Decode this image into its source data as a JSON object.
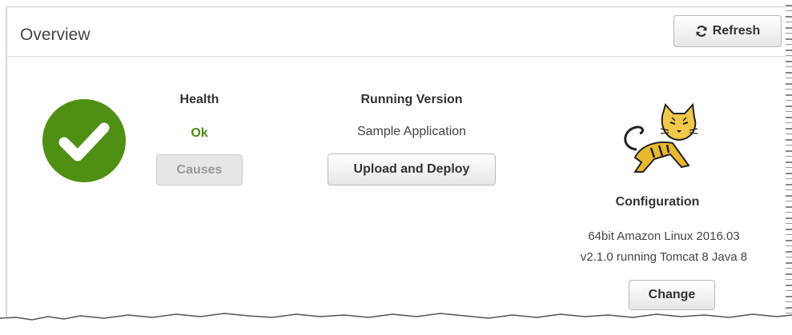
{
  "header": {
    "title": "Overview",
    "refresh_label": "Refresh",
    "refresh_icon": "refresh-icon"
  },
  "health": {
    "title": "Health",
    "status": "Ok",
    "status_color": "#4a8a12",
    "indicator_color": "#4f8f14",
    "indicator_icon": "checkmark-icon",
    "causes_label": "Causes"
  },
  "running_version": {
    "title": "Running Version",
    "value": "Sample Application",
    "upload_label": "Upload and Deploy"
  },
  "configuration": {
    "logo_icon": "tomcat-logo-icon",
    "title": "Configuration",
    "line1": "64bit Amazon Linux 2016.03",
    "line2": "v2.1.0 running Tomcat 8 Java 8",
    "change_label": "Change"
  }
}
